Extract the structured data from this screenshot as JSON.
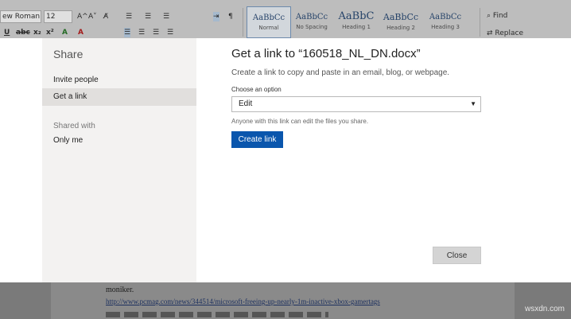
{
  "ribbon": {
    "font_name": "ew Roman",
    "font_size": "12",
    "row1_glyphs": [
      "A^",
      "A˅",
      "A̸",
      "☰",
      "☰",
      "☰",
      "¶"
    ],
    "row2_glyphs": [
      "U",
      "abc",
      "x₂",
      "x²",
      "A",
      "A"
    ],
    "styles": [
      {
        "preview": "AaBbCc",
        "name": "Normal"
      },
      {
        "preview": "AaBbCc",
        "name": "No Spacing"
      },
      {
        "preview": "AaBbC",
        "name": "Heading 1"
      },
      {
        "preview": "AaBbCc",
        "name": "Heading 2"
      },
      {
        "preview": "AaBbCc",
        "name": "Heading 3"
      }
    ],
    "find_label": "Find",
    "replace_label": "Replace"
  },
  "share_panel": {
    "title": "Share",
    "nav": [
      {
        "label": "Invite people",
        "selected": false
      },
      {
        "label": "Get a link",
        "selected": true
      }
    ],
    "shared_with_label": "Shared with",
    "shared_with_value": "Only me"
  },
  "dialog": {
    "title": "Get a link to “160518_NL_DN.docx”",
    "description": "Create a link to copy and paste in an email, blog, or webpage.",
    "option_label": "Choose an option",
    "option_value": "Edit",
    "option_note": "Anyone with this link can edit the files you share.",
    "create_link_label": "Create link",
    "close_label": "Close",
    "accent_color": "#0a56ad"
  },
  "document": {
    "line1": "moniker.",
    "link": "http://www.pcmag.com/news/344514/microsoft-freeing-up-nearly-1m-inactive-xbox-gamertags"
  },
  "watermark": "wsxdn.com"
}
